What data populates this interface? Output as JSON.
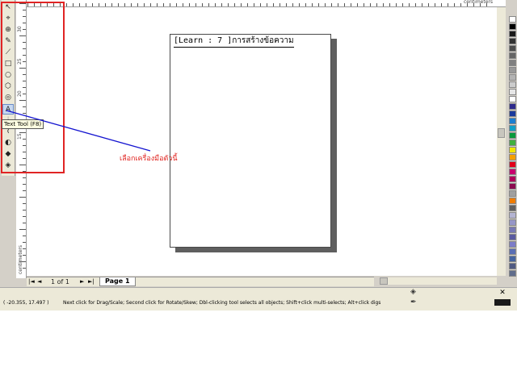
{
  "rulers": {
    "unit": "centimeters",
    "vertical_labels": [
      "30",
      "25",
      "20",
      "15"
    ]
  },
  "page": {
    "text": "[Learn : 7 ]การสร้างข้อความ"
  },
  "tooltip": {
    "text": "Text Tool (F8)"
  },
  "annotation": {
    "text": "เลือกเครื่องมือตัวนี้",
    "color": "#e0201c"
  },
  "navigator": {
    "first_btn": "|◄",
    "prev_btn": "◄",
    "page_count": "1 of 1",
    "next_btn": "►",
    "last_btn": "►|",
    "page_tab": "Page 1"
  },
  "status": {
    "coordinates": "( -20.355, 17.497 )",
    "hint": "Next click for Drag/Scale; Second click for Rotate/Skew; Dbl-clicking tool selects all objects; Shift+click multi-selects; Alt+click digs"
  },
  "fill_indicator": "✕",
  "tools": [
    {
      "name": "pick-tool-icon",
      "glyph": "↖",
      "active": false
    },
    {
      "name": "shape-tool-icon",
      "glyph": "⌖",
      "active": false
    },
    {
      "name": "zoom-tool-icon",
      "glyph": "⊕",
      "active": false
    },
    {
      "name": "freehand-tool-icon",
      "glyph": "✎",
      "active": false
    },
    {
      "name": "smart-drawing-icon",
      "glyph": "⟋",
      "active": false
    },
    {
      "name": "rectangle-tool-icon",
      "glyph": "□",
      "active": false
    },
    {
      "name": "ellipse-tool-icon",
      "glyph": "○",
      "active": false
    },
    {
      "name": "polygon-tool-icon",
      "glyph": "⬡",
      "active": false
    },
    {
      "name": "basic-shapes-icon",
      "glyph": "◎",
      "active": false
    },
    {
      "name": "text-tool-icon",
      "glyph": "A",
      "active": true
    },
    {
      "name": "interactive-tool-icon",
      "glyph": "⫶",
      "active": false
    },
    {
      "name": "eyedropper-tool-icon",
      "glyph": "⌇",
      "active": false
    },
    {
      "name": "outline-tool-icon",
      "glyph": "◐",
      "active": false
    },
    {
      "name": "fill-tool-icon",
      "glyph": "◆",
      "active": false
    },
    {
      "name": "interactive-fill-icon",
      "glyph": "◈",
      "active": false
    }
  ],
  "palette": [
    "#ffffff",
    "#000000",
    "#1a1a1a",
    "#333333",
    "#4d4d4d",
    "#666666",
    "#808080",
    "#999999",
    "#b3b3b3",
    "#cccccc",
    "#e6e6e6",
    "#ffffff",
    "#2e2a8c",
    "#1a3a9c",
    "#1d7fd1",
    "#12a0c8",
    "#0a9a3c",
    "#40b040",
    "#f0e600",
    "#f5a000",
    "#e2001a",
    "#c8006e",
    "#b0005a",
    "#8c0a50",
    "#a0a0a0",
    "#f07d00",
    "#606060",
    "#b4b4d2",
    "#9696c8",
    "#7878b4",
    "#5a5aa0",
    "#7c7cc8",
    "#5a6eb4",
    "#4664a0",
    "#505a82",
    "#606d8c"
  ]
}
